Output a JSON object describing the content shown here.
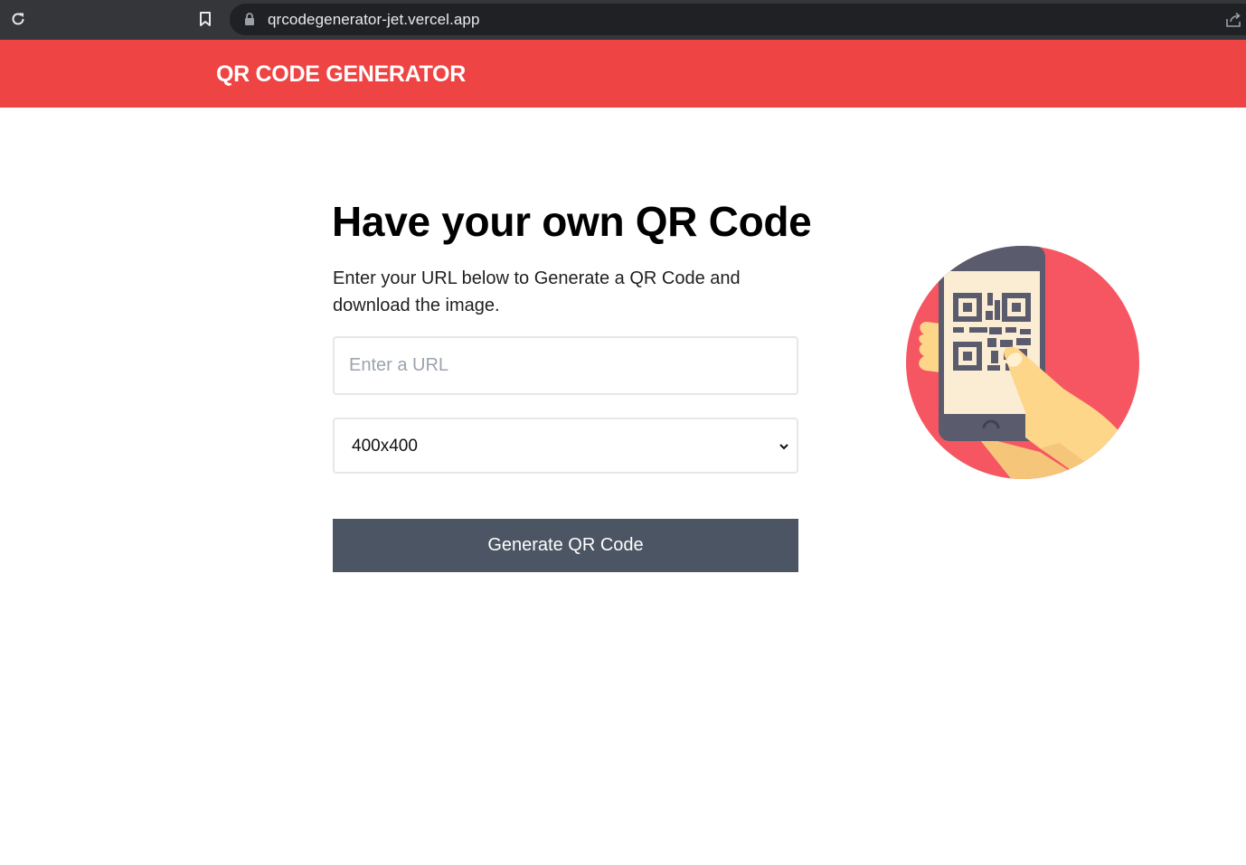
{
  "browser": {
    "url": "qrcodegenerator-jet.vercel.app",
    "icons": [
      "reload-icon",
      "bookmark-icon",
      "lock-icon",
      "share-icon"
    ]
  },
  "header": {
    "brand": "QR CODE GENERATOR",
    "background_color": "#ef4444"
  },
  "main": {
    "title": "Have your own QR Code",
    "description": "Enter your URL below to Generate a QR Code and download the image.",
    "url_input": {
      "placeholder": "Enter a URL",
      "value": ""
    },
    "size_select": {
      "selected": "400x400"
    },
    "generate_button": "Generate QR Code",
    "button_color": "#4b5563"
  },
  "illustration": {
    "icon": "phone-qr-scan-illustration",
    "colors": {
      "circle": "#f55661",
      "phone": "#5b5b6e",
      "screen": "#fbecd4",
      "hand": "#fdd68a",
      "hand_shadow": "#f5c57a"
    }
  }
}
